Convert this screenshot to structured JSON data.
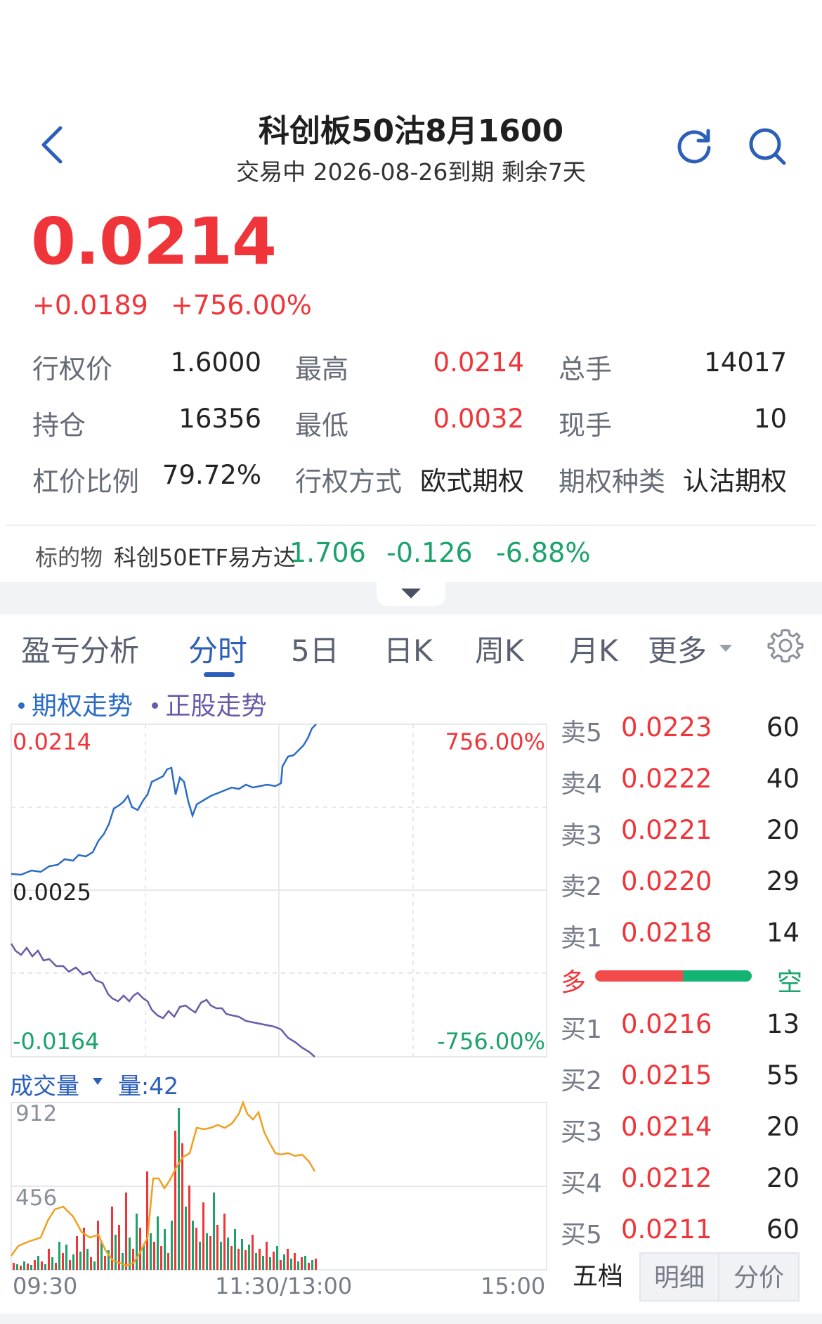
{
  "header": {
    "title": "科创板50沽8月1600",
    "subtitle": "交易中 2026-08-26到期 剩余7天",
    "icons": [
      "back-icon",
      "refresh-icon",
      "search-icon"
    ]
  },
  "quote": {
    "price": "0.0214",
    "change": "+0.0189",
    "change_pct": "+756.00%"
  },
  "stats": [
    {
      "label": "行权价",
      "value": "1.6000",
      "color": "#222222"
    },
    {
      "label": "最高",
      "value": "0.0214",
      "color": "#f0353a"
    },
    {
      "label": "总手",
      "value": "14017",
      "color": "#222222"
    },
    {
      "label": "持仓",
      "value": "16356",
      "color": "#222222"
    },
    {
      "label": "最低",
      "value": "0.0032",
      "color": "#f0353a"
    },
    {
      "label": "现手",
      "value": "10",
      "color": "#222222"
    },
    {
      "label": "杠价比例",
      "value": "79.72%",
      "color": "#222222"
    },
    {
      "label": "行权方式",
      "value": "欧式期权",
      "color": "#222222"
    },
    {
      "label": "期权种类",
      "value": "认沽期权",
      "color": "#222222"
    }
  ],
  "underlying": {
    "label": "标的物",
    "name": "科创50ETF易方达",
    "price": "1.706",
    "change": "-0.126",
    "change_pct": "-6.88%"
  },
  "tabs": [
    "盈亏分析",
    "分时",
    "5日",
    "日K",
    "周K",
    "月K",
    "更多"
  ],
  "active_tab": "分时",
  "legend": {
    "option": "期权走势",
    "stock": "正股走势"
  },
  "chart_labels": {
    "top_left": "0.0214",
    "top_right": "756.00%",
    "mid_left": "0.0025",
    "bottom_left": "-0.0164",
    "bottom_right": "-756.00%",
    "vol_top": "912",
    "vol_mid": "456",
    "time_start": "09:30",
    "time_mid": "11:30/13:00",
    "time_end": "15:00"
  },
  "volume": {
    "title": "成交量",
    "qty_label": "量:42"
  },
  "order_book": {
    "asks": [
      {
        "label": "卖5",
        "price": "0.0223",
        "qty": "60"
      },
      {
        "label": "卖4",
        "price": "0.0222",
        "qty": "40"
      },
      {
        "label": "卖3",
        "price": "0.0221",
        "qty": "20"
      },
      {
        "label": "卖2",
        "price": "0.0220",
        "qty": "29"
      },
      {
        "label": "卖1",
        "price": "0.0218",
        "qty": "14"
      }
    ],
    "long_label": "多",
    "short_label": "空",
    "bids": [
      {
        "label": "买1",
        "price": "0.0216",
        "qty": "13"
      },
      {
        "label": "买2",
        "price": "0.0215",
        "qty": "55"
      },
      {
        "label": "买3",
        "price": "0.0214",
        "qty": "20"
      },
      {
        "label": "买4",
        "price": "0.0212",
        "qty": "20"
      },
      {
        "label": "买5",
        "price": "0.0211",
        "qty": "60"
      }
    ]
  },
  "bottom_tabs": [
    "五档",
    "明细",
    "分价"
  ],
  "colors": {
    "up": "#f0353a",
    "down": "#1aa36a",
    "option_line": "#2b6cc4",
    "stock_line": "#6b5aa8",
    "avg_volume": "#f0a020",
    "accent": "#2b5fb8"
  }
}
